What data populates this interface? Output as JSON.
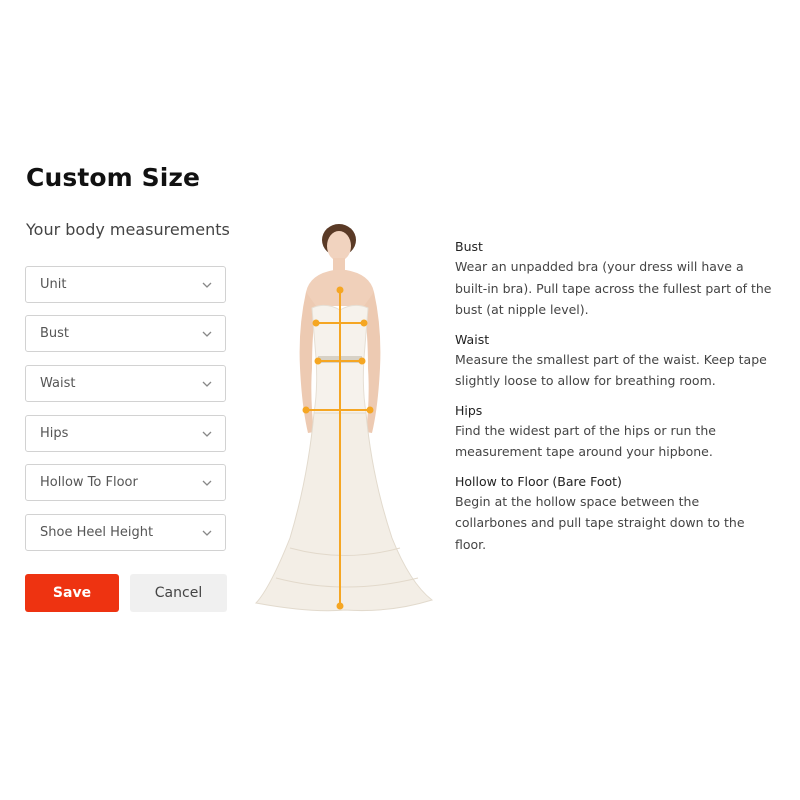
{
  "page": {
    "title": "Custom Size",
    "subtitle": "Your body measurements"
  },
  "form": {
    "fields": [
      {
        "label": "Unit"
      },
      {
        "label": "Bust"
      },
      {
        "label": "Waist"
      },
      {
        "label": "Hips"
      },
      {
        "label": "Hollow To Floor"
      },
      {
        "label": "Shoe Heel Height"
      }
    ],
    "save_label": "Save",
    "cancel_label": "Cancel"
  },
  "guide": [
    {
      "heading": "Bust",
      "text": "Wear an unpadded bra (your dress will have a built-in bra). Pull tape across the fullest part of the bust (at nipple level)."
    },
    {
      "heading": "Waist",
      "text": "Measure the smallest part of the waist. Keep tape slightly loose to allow for breathing room."
    },
    {
      "heading": "Hips",
      "text": "Find the widest part of the hips or run the measurement tape around your hipbone."
    },
    {
      "heading": "Hollow to Floor (Bare Foot)",
      "text": "Begin at the hollow space between the collarbones and pull tape straight down to the floor."
    }
  ],
  "colors": {
    "accent": "#ee3311",
    "measure_line": "#f5a623"
  },
  "icons": {
    "dropdown": "chevron-down-icon"
  }
}
